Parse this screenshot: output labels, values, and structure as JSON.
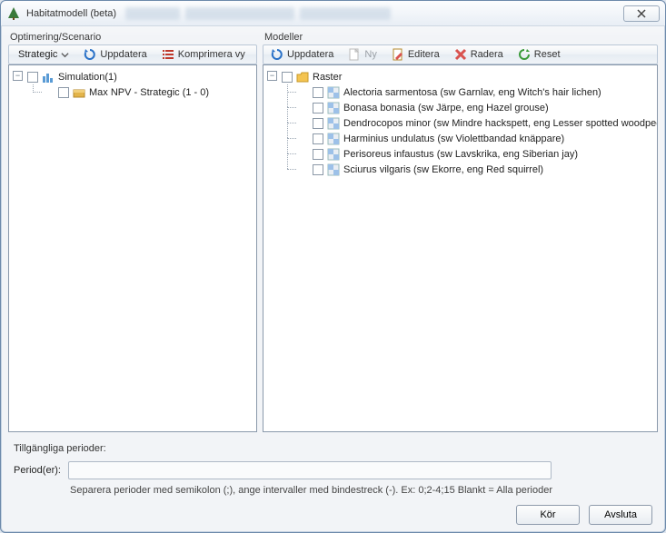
{
  "window": {
    "title": "Habitatmodell (beta)"
  },
  "left": {
    "section": "Optimering/Scenario",
    "dropdown_value": "Strategic",
    "update": "Uppdatera",
    "compress": "Komprimera vy",
    "tree": {
      "root": "Simulation(1)",
      "child": "Max NPV - Strategic (1 - 0)"
    }
  },
  "right": {
    "section": "Modeller",
    "update": "Uppdatera",
    "new": "Ny",
    "edit": "Editera",
    "delete": "Radera",
    "reset": "Reset",
    "tree": {
      "root": "Raster",
      "items": [
        "Alectoria sarmentosa (sw Garnlav, eng Witch's hair lichen)",
        "Bonasa bonasia (sw Järpe, eng Hazel grouse)",
        "Dendrocopos minor (sw Mindre hackspett, eng Lesser spotted woodpecker)",
        "Harminius undulatus (sw Violettbandad knäppare)",
        "Perisoreus infaustus (sw Lavskrika, eng Siberian jay)",
        "Sciurus vilgaris (sw Ekorre, eng Red squirrel)"
      ]
    }
  },
  "periods": {
    "header": "Tillgängliga perioder:",
    "label": "Period(er):",
    "placeholder": "",
    "hint": "Separera perioder med semikolon (;), ange intervaller med bindestreck (-). Ex: 0;2-4;15   Blankt = Alla perioder"
  },
  "footer": {
    "run": "Kör",
    "close": "Avsluta"
  },
  "icons": {
    "refresh": "refresh-icon",
    "list": "list-icon",
    "page": "page-icon",
    "edit": "edit-icon",
    "x": "x-icon",
    "reset": "reset-icon",
    "sim": "sim-icon",
    "box": "box-icon",
    "folder": "folder-icon",
    "model": "model-icon"
  }
}
